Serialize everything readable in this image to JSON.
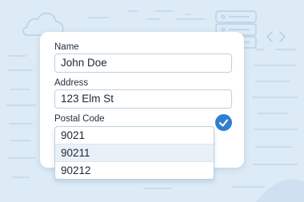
{
  "form": {
    "name_label": "Name",
    "name_value": "John Doe",
    "address_label": "Address",
    "address_value": "123 Elm St",
    "postal_label": "Postal Code",
    "postal_value": "9021"
  },
  "autocomplete": {
    "options": [
      "90211",
      "90212"
    ],
    "highlighted_index": 0
  },
  "colors": {
    "background": "#dcebf6",
    "accent": "#2f7fd0",
    "border": "#bcd0e0"
  },
  "icons": [
    "cloud-icon",
    "server-icon",
    "code-icon",
    "check-icon"
  ]
}
